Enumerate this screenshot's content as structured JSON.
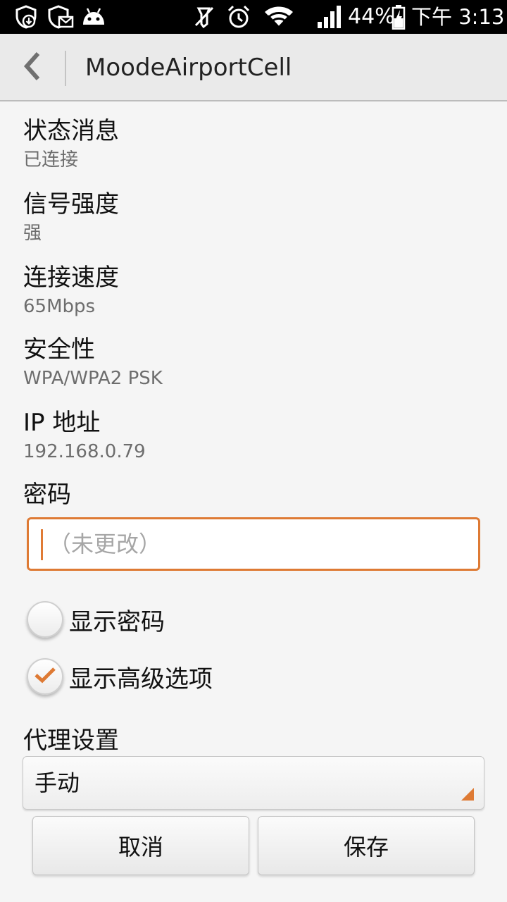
{
  "status_bar": {
    "battery": "44%",
    "time": "下午 3:13",
    "icons": [
      "shield-download-icon",
      "shield-mail-icon",
      "android-icon",
      "mute-icon",
      "alarm-icon",
      "wifi-icon",
      "signal-icon",
      "battery-charging-icon"
    ]
  },
  "header": {
    "back_icon": "chevron-left-icon",
    "title": "MoodeAirportCell"
  },
  "details": [
    {
      "label": "状态消息",
      "value": "已连接"
    },
    {
      "label": "信号强度",
      "value": "强"
    },
    {
      "label": "连接速度",
      "value": "65Mbps"
    },
    {
      "label": "安全性",
      "value": "WPA/WPA2 PSK"
    },
    {
      "label": "IP 地址",
      "value": "192.168.0.79"
    }
  ],
  "password": {
    "label": "密码",
    "placeholder": "（未更改）",
    "value": ""
  },
  "options": {
    "show_password": {
      "label": "显示密码",
      "checked": false
    },
    "show_advanced": {
      "label": "显示高级选项",
      "checked": true
    }
  },
  "proxy": {
    "label": "代理设置",
    "selected": "手动"
  },
  "buttons": {
    "cancel": "取消",
    "save": "保存"
  },
  "colors": {
    "accent": "#de7a34",
    "status_bar": "#000000",
    "action_bar": "#eaeaea",
    "background": "#f5f5f5"
  }
}
